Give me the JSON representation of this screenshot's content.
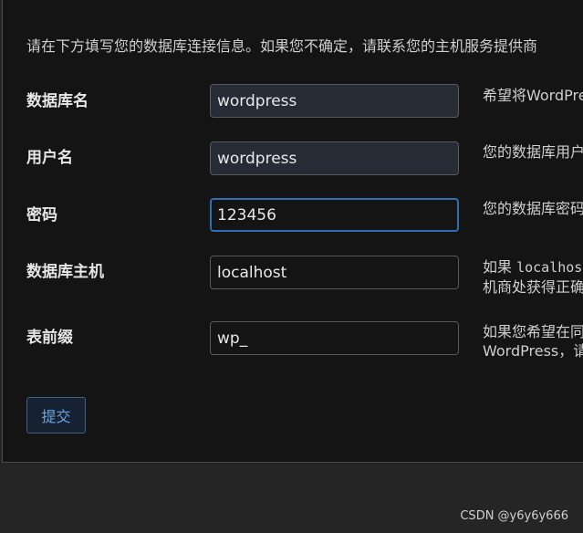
{
  "intro": "请在下方填写您的数据库连接信息。如果您不确定，请联系您的主机服务提供商",
  "fields": [
    {
      "label": "数据库名",
      "value": "wordpress",
      "desc_line1": "希望将WordPress",
      "desc_line2": ""
    },
    {
      "label": "用户名",
      "value": "wordpress",
      "desc_line1": "您的数据库用户名",
      "desc_line2": ""
    },
    {
      "label": "密码",
      "value": "123456",
      "desc_line1": "您的数据库密码",
      "desc_line2": ""
    },
    {
      "label": "数据库主机",
      "value": "localhost",
      "desc_line1_prefix": "如果 ",
      "desc_line1_code": "localhost",
      "desc_line2": "机商处获得正确"
    },
    {
      "label": "表前缀",
      "value": "wp_",
      "desc_line1": "如果您希望在同",
      "desc_line2": "WordPress，请"
    }
  ],
  "submit_label": "提交",
  "watermark": "CSDN @y6y6y666"
}
